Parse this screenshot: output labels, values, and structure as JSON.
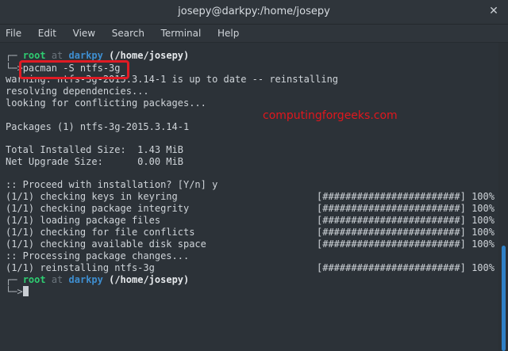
{
  "window": {
    "title": "josepy@darkpy:/home/josepy",
    "close_symbol": "✕"
  },
  "menu": [
    "File",
    "Edit",
    "View",
    "Search",
    "Terminal",
    "Help"
  ],
  "prompt": {
    "user": "root",
    "at": "at",
    "host": "darkpy",
    "path": "(/home/josepy)",
    "corner_top": "┌─",
    "corner_bottom": "└─>"
  },
  "command": "pacman -S ntfs-3g",
  "output": [
    "warning: ntfs-3g-2015.3.14-1 is up to date -- reinstalling",
    "resolving dependencies...",
    "looking for conflicting packages...",
    "",
    "Packages (1) ntfs-3g-2015.3.14-1",
    "",
    "Total Installed Size:  1.43 MiB",
    "Net Upgrade Size:      0.00 MiB",
    "",
    ":: Proceed with installation? [Y/n] y",
    "(1/1) checking keys in keyring",
    "(1/1) checking package integrity",
    "(1/1) loading package files",
    "(1/1) checking for file conflicts",
    "(1/1) checking available disk space",
    ":: Processing package changes...",
    "(1/1) reinstalling ntfs-3g"
  ],
  "progress_bar": "[########################] 100%",
  "watermark": "computingforgeeks.com"
}
